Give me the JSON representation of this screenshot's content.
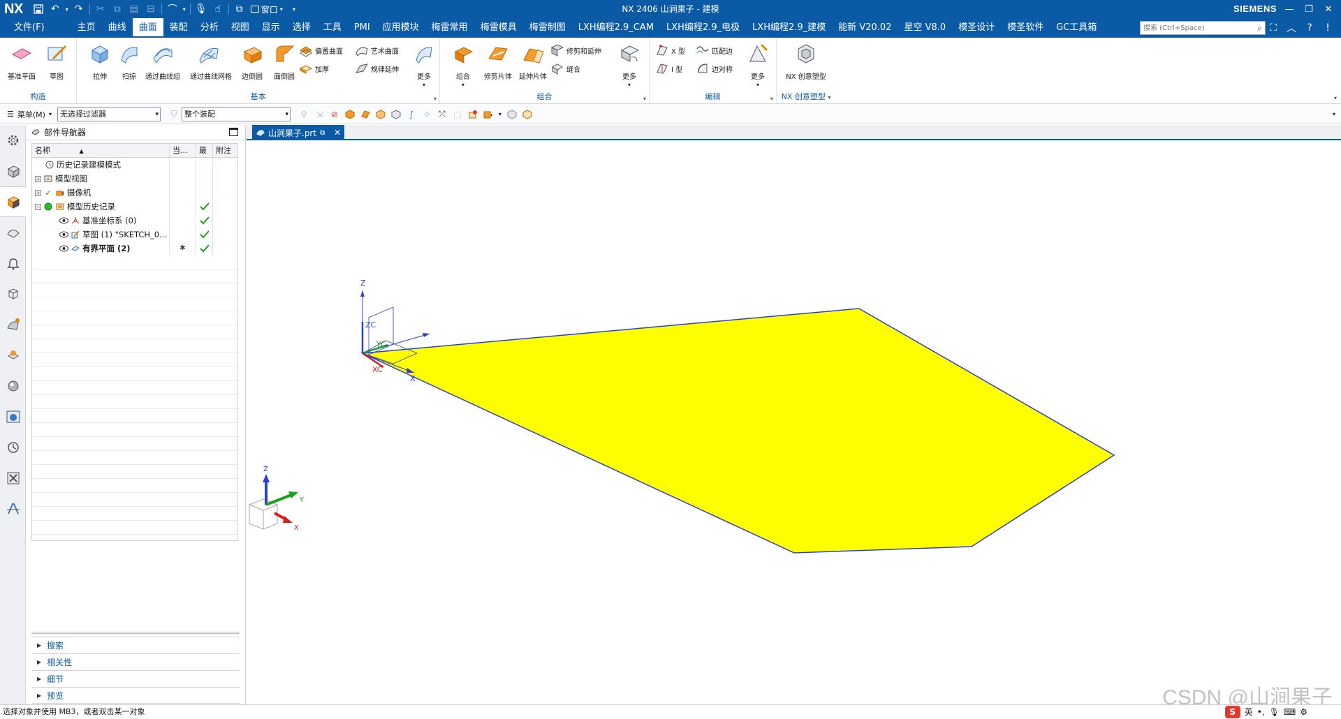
{
  "titlebar": {
    "logo": "NX",
    "window_menu": "窗口",
    "title": "NX 2406 山涧果子 - 建模",
    "brand": "SIEMENS"
  },
  "menubar": {
    "items": [
      {
        "label": "文件(F)"
      },
      {
        "label": "主页"
      },
      {
        "label": "曲线"
      },
      {
        "label": "曲面",
        "active": true
      },
      {
        "label": "装配"
      },
      {
        "label": "分析"
      },
      {
        "label": "视图"
      },
      {
        "label": "显示"
      },
      {
        "label": "选择"
      },
      {
        "label": "工具"
      },
      {
        "label": "PMI"
      },
      {
        "label": "应用模块"
      },
      {
        "label": "梅雷常用"
      },
      {
        "label": "梅雷模具"
      },
      {
        "label": "梅雷制图"
      },
      {
        "label": "LXH编程2.9_CAM"
      },
      {
        "label": "LXH编程2.9_电极"
      },
      {
        "label": "LXH编程2.9_建模"
      },
      {
        "label": "能新 V20.02"
      },
      {
        "label": "星空 V8.0"
      },
      {
        "label": "模圣设计"
      },
      {
        "label": "模圣软件"
      },
      {
        "label": "GC工具箱"
      }
    ],
    "search_placeholder": "搜索 (Ctrl+Space)"
  },
  "ribbon": {
    "groups": {
      "construct": "构造",
      "basic": "基本",
      "combine": "组合",
      "edit": "编辑",
      "nx_creative": "NX 创意塑型"
    },
    "construct_items": [
      "基准平面",
      "草图"
    ],
    "basic_big": [
      "拉伸",
      "扫掠",
      "通过曲线组",
      "通过曲线网格",
      "边倒圆",
      "面倒圆"
    ],
    "basic_small": [
      "偏置曲面",
      "艺术曲面",
      "加厚",
      "规律延伸"
    ],
    "basic_more": "更多",
    "combine_big": [
      "组合",
      "修剪片体",
      "延伸片体"
    ],
    "combine_small": [
      "修剪和延伸",
      "缝合"
    ],
    "combine_more": "更多",
    "edit_small": [
      "X 型",
      "匹配边",
      "I 型",
      "边对称"
    ],
    "edit_more": "更多",
    "nx_creative_item": "NX 创意塑型"
  },
  "toolbar": {
    "menu_label": "菜单(M)",
    "filter_value": "无选择过滤器",
    "scope_value": "整个装配"
  },
  "navigator": {
    "title": "部件导航器",
    "columns": [
      "名称",
      "当...",
      "最",
      "附注"
    ],
    "rows": [
      {
        "label": "历史记录建模模式",
        "icon": "clock-icon",
        "check": false,
        "bold": false
      },
      {
        "label": "模型视图",
        "icon": "views-icon",
        "expand": "+",
        "check": false,
        "bold": false
      },
      {
        "label": "摄像机",
        "icon": "camera-icon",
        "expand": "+",
        "check": false,
        "bold": false
      },
      {
        "label": "模型历史记录",
        "icon": "history-icon",
        "expand": "−",
        "check": true,
        "bold": false
      },
      {
        "label": "基准坐标系 (0)",
        "icon": "datum-csys-icon",
        "check": true,
        "bold": false
      },
      {
        "label": "草图 (1) \"SKETCH_0...",
        "icon": "sketch-icon",
        "check": true,
        "bold": false
      },
      {
        "label": "有界平面 (2)",
        "icon": "bounded-plane-icon",
        "check": true,
        "bold": true,
        "current": "✱"
      }
    ],
    "panels": [
      "搜索",
      "相关性",
      "细节",
      "预览"
    ]
  },
  "document_tab": {
    "label": "山涧果子.prt"
  },
  "viewport": {
    "triad_labels": {
      "z": "Z",
      "zc": "ZC",
      "yc": "YC",
      "xc": "XC",
      "x": "X",
      "y": "Y"
    },
    "shape_fill": "#ffff00",
    "shape_edge": "#2b3fd4"
  },
  "statusbar": {
    "message": "选择对象并使用 MB3，或者双击某一对象"
  },
  "watermark": "CSDN @山涧果子",
  "ime": {
    "lang": "英"
  },
  "colors": {
    "accent": "#0b5aa6",
    "check": "#1aa31a"
  }
}
